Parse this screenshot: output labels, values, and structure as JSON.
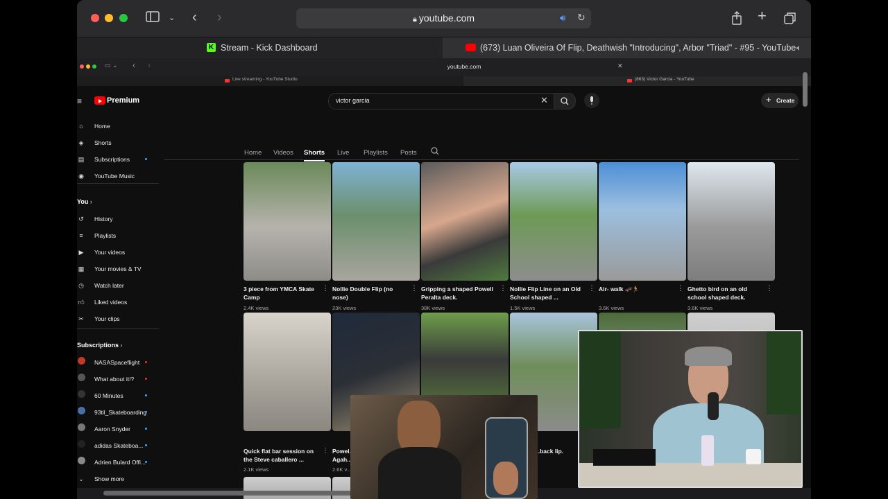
{
  "browser": {
    "address": "youtube.com",
    "tabs": [
      {
        "label": "Stream - Kick Dashboard"
      },
      {
        "label": "(673) Luan Oliveira Of Flip, Deathwish \"Introducing\", Arbor \"Triad\" - #95 - YouTube"
      }
    ]
  },
  "inner_browser": {
    "address": "youtube.com",
    "tabs": [
      {
        "label": "Live streaming - YouTube Studio"
      },
      {
        "label": "(863) Victor Garcia - YouTube"
      }
    ]
  },
  "youtube": {
    "logo": "Premium",
    "search_value": "victor garcia",
    "create_label": "Create",
    "channel_tabs": [
      "Home",
      "Videos",
      "Shorts",
      "Live",
      "Playlists",
      "Posts"
    ],
    "active_tab": "Shorts",
    "nav_main": [
      {
        "label": "Home",
        "icon": "home-icon"
      },
      {
        "label": "Shorts",
        "icon": "shorts-icon"
      },
      {
        "label": "Subscriptions",
        "icon": "subscriptions-icon"
      },
      {
        "label": "YouTube Music",
        "icon": "music-icon"
      }
    ],
    "you_heading": "You",
    "nav_you": [
      {
        "label": "History",
        "icon": "history-icon"
      },
      {
        "label": "Playlists",
        "icon": "playlists-icon"
      },
      {
        "label": "Your videos",
        "icon": "your-videos-icon"
      },
      {
        "label": "Your movies & TV",
        "icon": "movies-icon"
      },
      {
        "label": "Watch later",
        "icon": "watch-later-icon"
      },
      {
        "label": "Liked videos",
        "icon": "liked-icon"
      },
      {
        "label": "Your clips",
        "icon": "clips-icon"
      }
    ],
    "subscriptions_heading": "Subscriptions",
    "subscriptions": [
      {
        "label": "NASASpaceflight"
      },
      {
        "label": "What about it!?"
      },
      {
        "label": "60 Minutes"
      },
      {
        "label": "93til_Skateboarding"
      },
      {
        "label": "Aaron Snyder"
      },
      {
        "label": "adidas Skateboa..."
      },
      {
        "label": "Adrien Bulard Offi..."
      }
    ],
    "show_more": "Show more",
    "shorts_row1": [
      {
        "title": "3 piece from YMCA Skate Camp",
        "views": "2.4K views"
      },
      {
        "title": "Nollie Double Flip (no nose)",
        "views": "23K views"
      },
      {
        "title": "Gripping a shaped Powell Peralta deck.",
        "views": "38K views"
      },
      {
        "title": "Nollie Flip Line on an Old School shaped ...",
        "views": "1.5K views"
      },
      {
        "title": "Air- walk 🛹🏃",
        "views": "3.6K views"
      },
      {
        "title": "Ghetto bird on an old school shaped deck.",
        "views": "3.6K views"
      }
    ],
    "shorts_row2": [
      {
        "title": "Quick flat bar session on the Steve caballero ...",
        "views": "2.1K views"
      },
      {
        "title": "Powel... Agah...",
        "views": "2.6K v..."
      },
      {
        "title": "",
        "views": ""
      },
      {
        "title": "...back lip.",
        "views": ""
      }
    ]
  }
}
